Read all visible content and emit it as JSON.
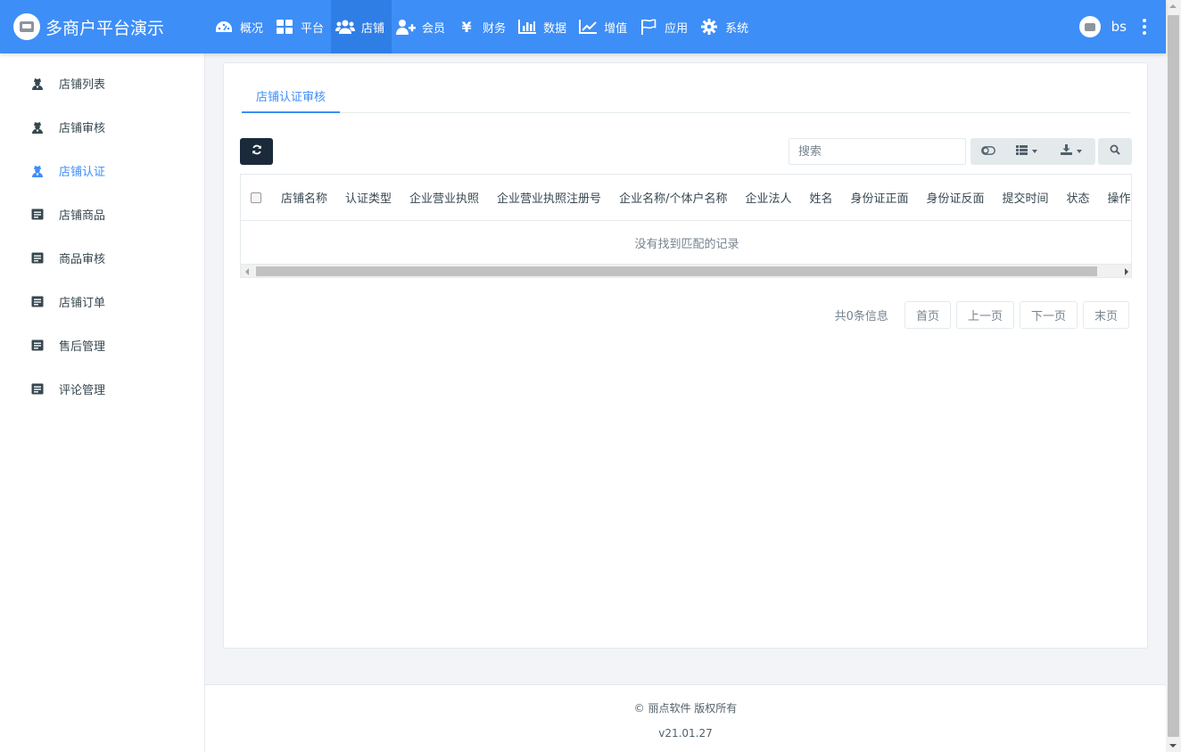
{
  "brand": {
    "title": "多商户平台演示"
  },
  "nav": [
    {
      "label": "概况",
      "icon": "dashboard-icon"
    },
    {
      "label": "平台",
      "icon": "grid-icon"
    },
    {
      "label": "店铺",
      "icon": "users-icon",
      "active": true
    },
    {
      "label": "会员",
      "icon": "user-plus-icon"
    },
    {
      "label": "财务",
      "icon": "yen-icon"
    },
    {
      "label": "数据",
      "icon": "bar-chart-icon"
    },
    {
      "label": "增值",
      "icon": "line-chart-icon"
    },
    {
      "label": "应用",
      "icon": "flag-icon"
    },
    {
      "label": "系统",
      "icon": "gear-icon"
    }
  ],
  "user": {
    "name": "bs"
  },
  "sidebar": {
    "items": [
      {
        "label": "店铺列表",
        "icon": "user-secret-icon"
      },
      {
        "label": "店铺审核",
        "icon": "user-secret-icon"
      },
      {
        "label": "店铺认证",
        "icon": "user-secret-icon",
        "active": true
      },
      {
        "label": "店铺商品",
        "icon": "list-alt-icon"
      },
      {
        "label": "商品审核",
        "icon": "list-alt-icon"
      },
      {
        "label": "店铺订单",
        "icon": "list-alt-icon"
      },
      {
        "label": "售后管理",
        "icon": "list-alt-icon"
      },
      {
        "label": "评论管理",
        "icon": "list-alt-icon"
      }
    ]
  },
  "main": {
    "tab": "店铺认证审核",
    "search": {
      "placeholder": "搜索"
    },
    "table": {
      "columns": [
        "店铺名称",
        "认证类型",
        "企业营业执照",
        "企业营业执照注册号",
        "企业名称/个体户名称",
        "企业法人",
        "姓名",
        "身份证正面",
        "身份证反面",
        "提交时间",
        "状态",
        "操作"
      ],
      "empty_text": "没有找到匹配的记录"
    },
    "pager": {
      "info": "共0条信息",
      "first": "首页",
      "prev": "上一页",
      "next": "下一页",
      "last": "末页"
    }
  },
  "footer": {
    "copyright": "© 丽点软件 版权所有",
    "version": "v21.01.27"
  },
  "colors": {
    "primary": "#3e8ef7",
    "refresh_button": "#1a2a3a"
  }
}
